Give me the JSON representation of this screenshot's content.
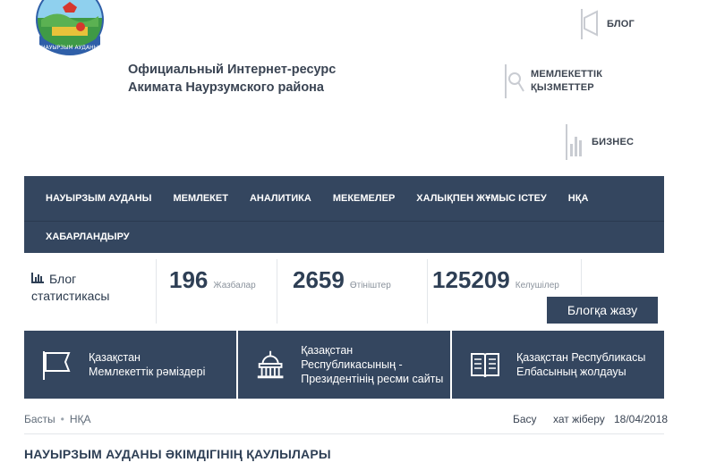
{
  "header": {
    "title_line1": "Официальный Интернет-ресурс",
    "title_line2": "Акимата Наурзумского района"
  },
  "quick_links": [
    {
      "icon": "megaphone-icon",
      "line1": "БЛОГ",
      "line2": ""
    },
    {
      "icon": "services-icon",
      "line1": "МЕМЛЕКЕТТІК",
      "line2": "ҚЫЗМЕТТЕР"
    },
    {
      "icon": "chart-icon",
      "line1": "БИЗНЕС",
      "line2": ""
    }
  ],
  "nav": {
    "row1": [
      "НАУЫРЗЫМ АУДАНЫ",
      "МЕМЛЕКЕТ",
      "АНАЛИТИКА",
      "МЕКЕМЕЛЕР",
      "ХАЛЫҚПЕН ЖҰМЫС ІСТЕУ",
      "НҚА"
    ],
    "row2": [
      "ХАБАРЛАНДЫРУ"
    ]
  },
  "stats": {
    "label_line1": "Блог",
    "label_line2": "статистикасы",
    "items": [
      {
        "value": "196",
        "label": "Жазбалар"
      },
      {
        "value": "2659",
        "label": "Өтініштер"
      },
      {
        "value": "125209",
        "label": "Келушілер"
      }
    ],
    "button": "Блогқа жазу"
  },
  "cards": [
    {
      "icon": "flag-icon",
      "line1": "Қазақстан",
      "line2": "Мемлекеттік рәміздері"
    },
    {
      "icon": "capitol-icon",
      "line1": "Қазақстан Республикасының -",
      "line2": "Президентінің ресми сайты"
    },
    {
      "icon": "book-icon",
      "line1": "Қазақстан Республикасы",
      "line2": "Елбасының жолдауы"
    }
  ],
  "breadcrumb": {
    "home": "Басты",
    "current": "НҚА"
  },
  "tools": {
    "print": "Басу",
    "send": "хат жіберу",
    "date": "18/04/2018"
  },
  "page_title": "НАУЫРЗЫМ АУДАНЫ ӘКІМДІГІНІҢ ҚАУЛЫЛАРЫ",
  "colors": {
    "nav_bg": "#34465f",
    "text": "#2e3f55"
  }
}
